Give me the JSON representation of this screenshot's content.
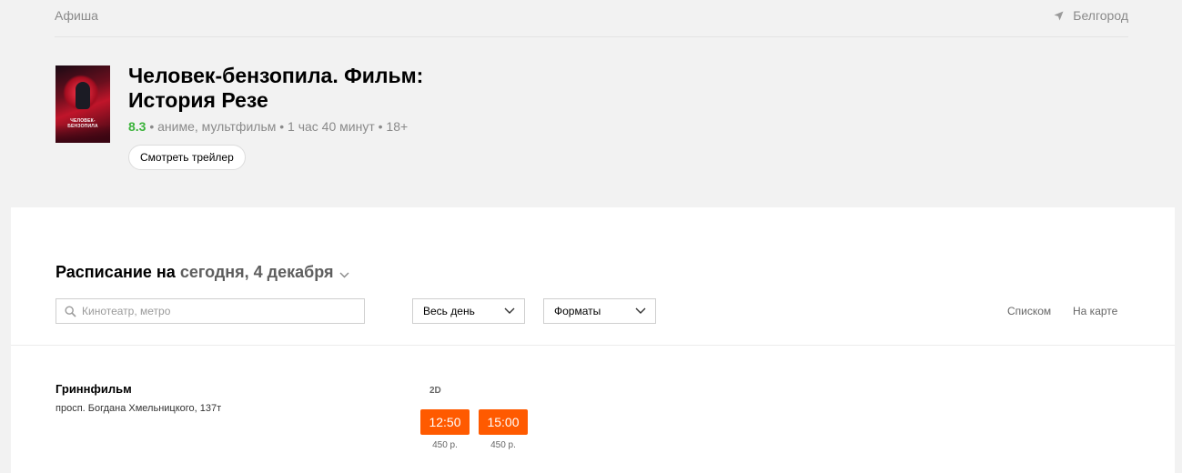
{
  "header": {
    "brand": "Афиша",
    "city": "Белгород",
    "city_icon": "location-arrow-icon"
  },
  "movie": {
    "poster_title": "ЧЕЛОВЕК-БЕНЗОПИЛА",
    "title": "Человек-бензопила. Фильм: История Резе",
    "rating": "8.3",
    "meta_rest": " • аниме, мультфильм • 1 час 40 минут • 18+",
    "trailer_label": "Смотреть трейлер"
  },
  "schedule": {
    "title_prefix": "Расписание на",
    "date": "сегодня, 4 декабря",
    "search_placeholder": "Кинотеатр, метро",
    "search_value": "",
    "time_filter": "Весь день",
    "format_filter": "Форматы",
    "view_list": "Списком",
    "view_map": "На карте"
  },
  "cinemas": [
    {
      "name": "Гриннфильм",
      "address": "просп. Богдана Хмельницкого, 137т",
      "format": "2D",
      "sessions": [
        {
          "time": "12:50",
          "price": "450 р."
        },
        {
          "time": "15:00",
          "price": "450 р."
        }
      ]
    }
  ],
  "colors": {
    "accent_session": "#ff5a00",
    "rating_green": "#3bb33b",
    "background": "#f2f2f2",
    "panel": "#ffffff"
  }
}
